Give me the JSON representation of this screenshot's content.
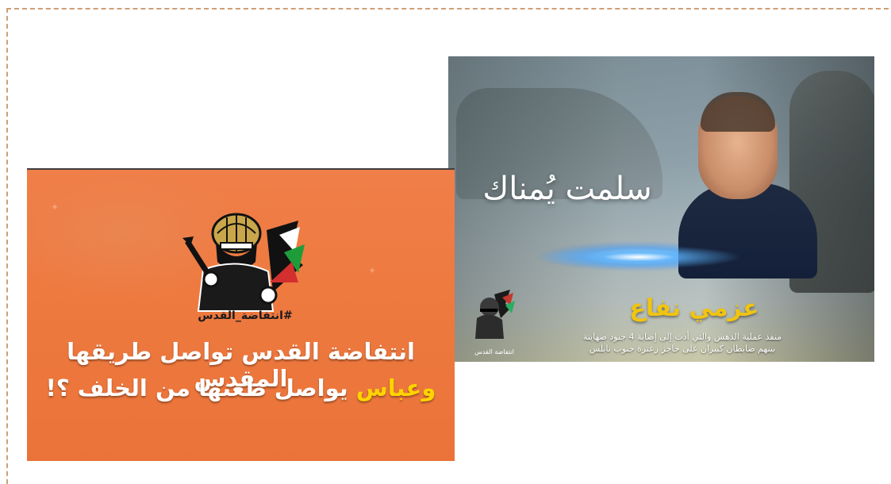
{
  "right_poster": {
    "slogan": "سلمت يُمناك",
    "name": "عزمي نفاع",
    "caption_line1": "منفذ عملية الدهس والتي أدت إلى إصابة 4 جنود صهاينة",
    "caption_line2": "بينهم ضابطان كبيران على حاجز زعترة جنوب نابلس",
    "logo_label": "انتفاضة القدس"
  },
  "left_poster": {
    "hashtag": "#انتفاضة_القدس",
    "headline_line1": "انتفاضة القدس تواصل طريقها المقدس",
    "headline_line2_highlight": "وعباس",
    "headline_line2_rest": " يواصل طعنها من الخلف ؟!",
    "colors": {
      "background": "#ee7a40",
      "highlight": "#ffd400"
    }
  }
}
